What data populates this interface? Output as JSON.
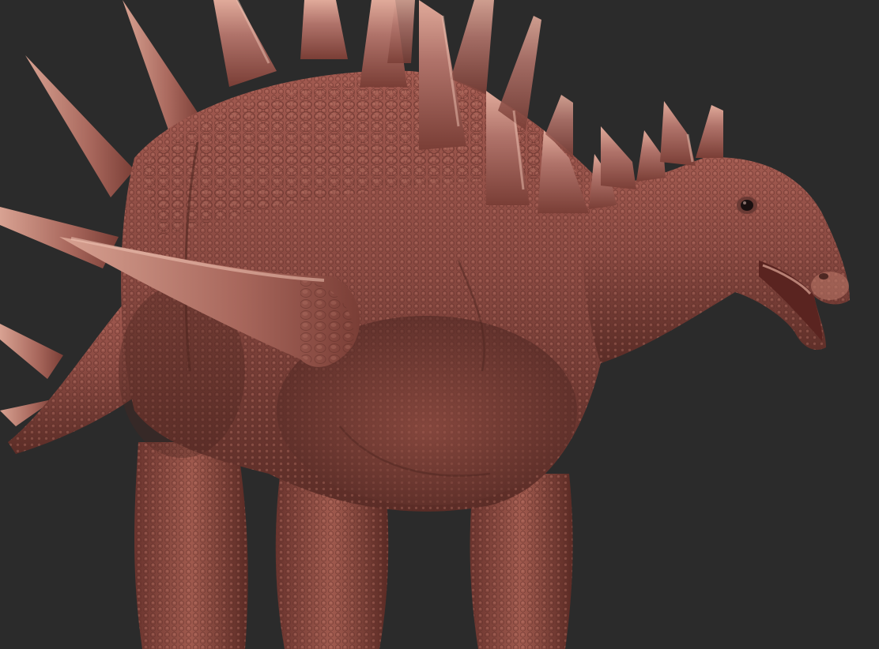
{
  "viewport": {
    "background_color": "#2b2b2b"
  },
  "model": {
    "subject": "kentrosaurus-sculpt",
    "palette": {
      "skin_base": "#8a4a42",
      "skin_light": "#b0685c",
      "skin_shadow": "#4a2420",
      "spike_base": "#9c5a50",
      "spike_tip": "#d49a8a",
      "spike_highlight": "#f0c4b4",
      "eye": "#1a1010",
      "mouth_inner": "#5a2420"
    }
  }
}
